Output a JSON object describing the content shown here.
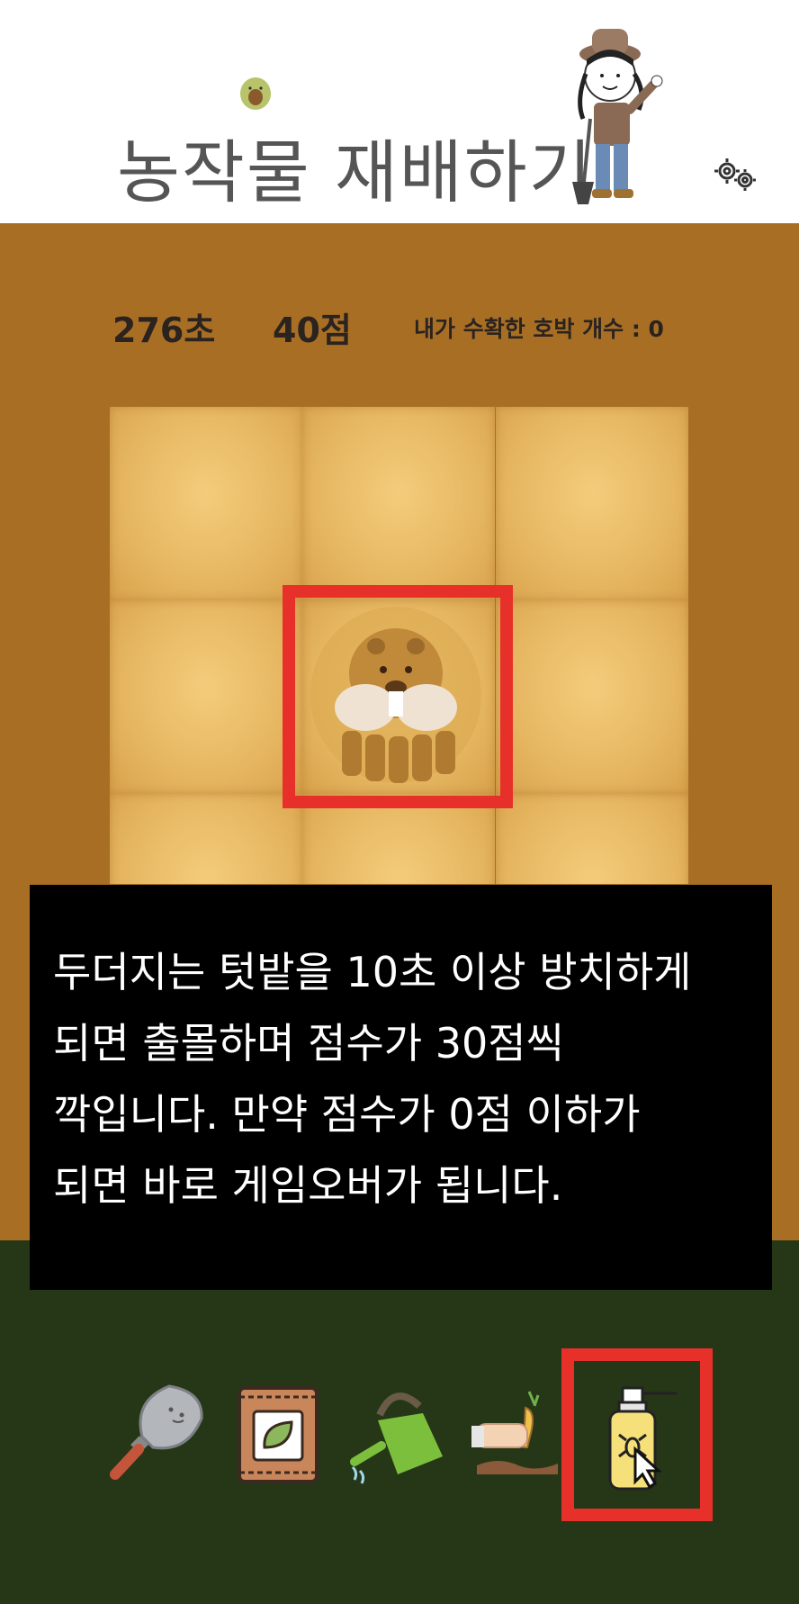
{
  "header": {
    "title": "농작물 재배하기"
  },
  "stats": {
    "time": "276초",
    "score": "40점",
    "harvest": "내가 수확한 호박 개수 : 0"
  },
  "board": {
    "rows": 3,
    "cols": 3,
    "mole_cell": "row 2, col 2"
  },
  "info": {
    "lines": [
      "두더지는 텃밭을 10초 이상 방치하게",
      "되면 출몰하며 점수가 30점씩",
      "깍입니다. 만약 점수가 0점 이하가",
      "되면 바로 게임오버가 됩니다."
    ]
  },
  "toolbar": {
    "tools": [
      "trowel-icon",
      "seed-bag-icon",
      "watering-can-icon",
      "harvest-hand-icon",
      "pest-spray-icon"
    ],
    "selected": "pest-spray-icon"
  },
  "colors": {
    "field": "#a86f24",
    "ground": "#263718",
    "highlight": "#e8302a",
    "soil_tile": "#e7b863"
  }
}
